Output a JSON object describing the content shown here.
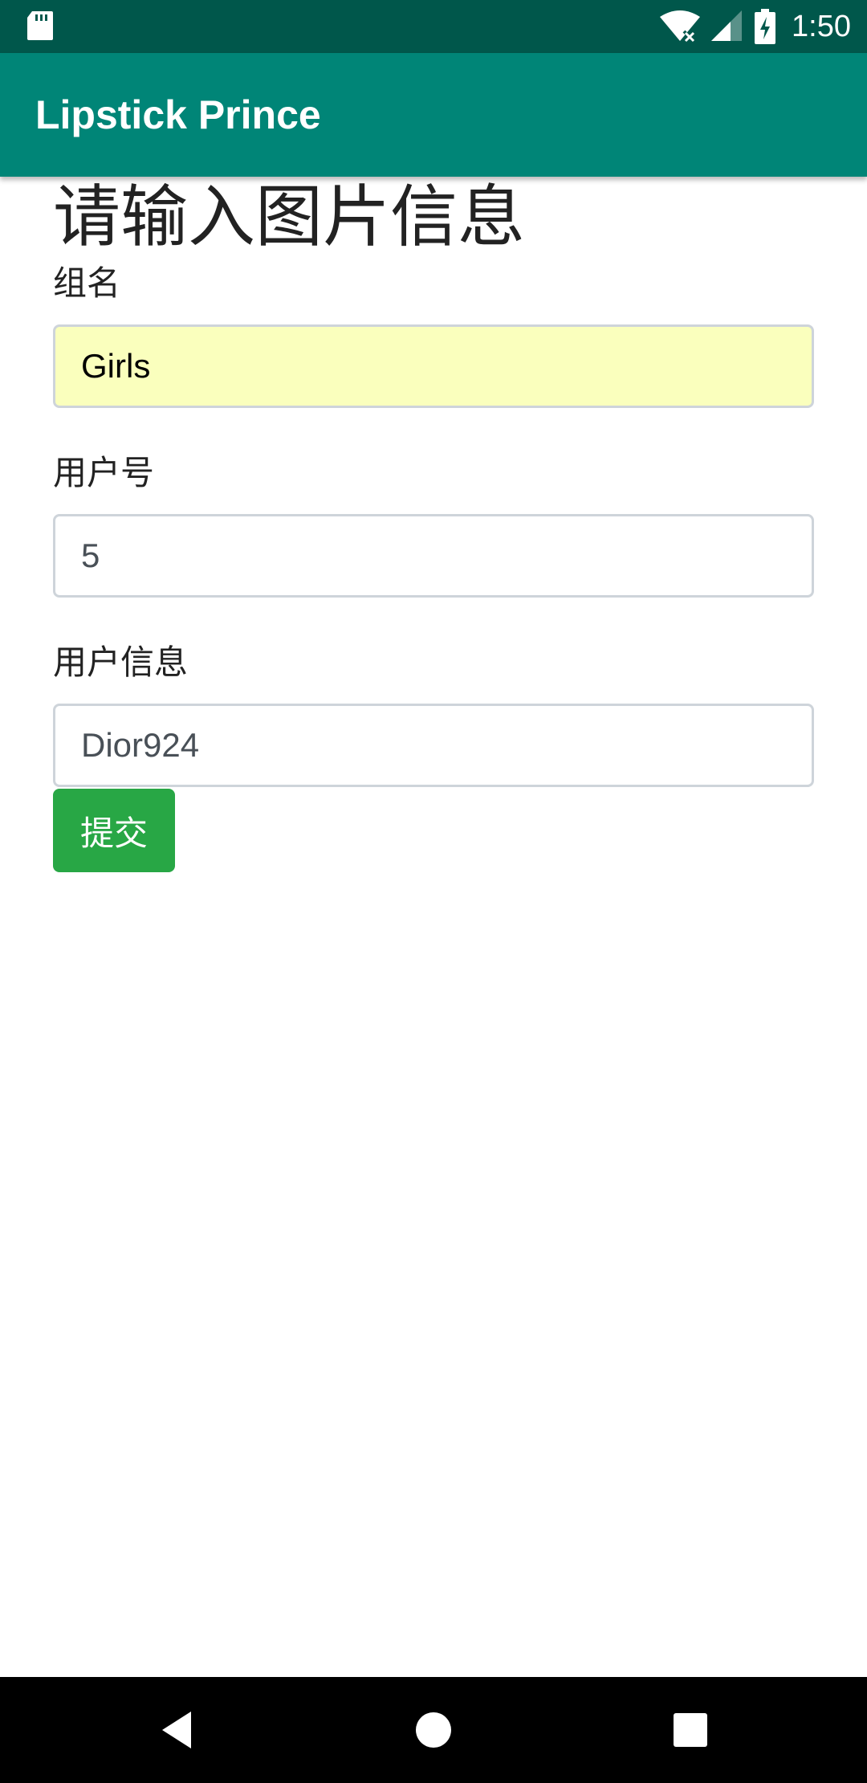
{
  "status_bar": {
    "time": "1:50",
    "icons": [
      "sd-card-icon",
      "wifi-icon",
      "signal-icon",
      "battery-charging-icon"
    ]
  },
  "app_bar": {
    "title": "Lipstick Prince",
    "color": "#008577"
  },
  "form": {
    "heading": "请输入图片信息",
    "fields": [
      {
        "label": "组名",
        "value": "Girls"
      },
      {
        "label": "用户号",
        "value": "5"
      },
      {
        "label": "用户信息",
        "value": "Dior924"
      }
    ],
    "submit_label": "提交",
    "submit_color": "#28a745",
    "autofill_color": "#faffbd"
  },
  "nav_bar": {
    "icons": [
      "back-icon",
      "home-icon",
      "recents-icon"
    ]
  }
}
